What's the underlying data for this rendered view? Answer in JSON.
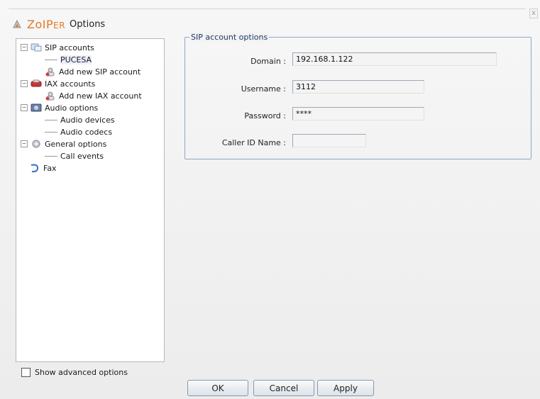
{
  "window": {
    "brand": "ZoIP",
    "brand_suffix": "ER",
    "title": "Options",
    "close_glyph": "x"
  },
  "tree": {
    "sip_accounts": "SIP accounts",
    "pucesa": "PUCESA",
    "add_sip": "Add new SIP account",
    "iax_accounts": "IAX accounts",
    "add_iax": "Add new IAX account",
    "audio_options": "Audio options",
    "audio_devices": "Audio devices",
    "audio_codecs": "Audio codecs",
    "general_options": "General options",
    "call_events": "Call events",
    "fax": "Fax",
    "expand_glyph": "−"
  },
  "advanced": {
    "label": "Show advanced options",
    "checked": false
  },
  "sip_options": {
    "legend": "SIP account options",
    "domain_label": "Domain :",
    "domain_value": "192.168.1.122",
    "username_label": "Username :",
    "username_value": "3112",
    "password_label": "Password :",
    "password_value": "****",
    "callerid_label": "Caller ID Name :",
    "callerid_value": ""
  },
  "buttons": {
    "ok": "OK",
    "cancel": "Cancel",
    "apply": "Apply"
  },
  "colors": {
    "brand": "#e07a2a",
    "group_border": "#8fa6c9",
    "button_border": "#7e9ab7"
  }
}
